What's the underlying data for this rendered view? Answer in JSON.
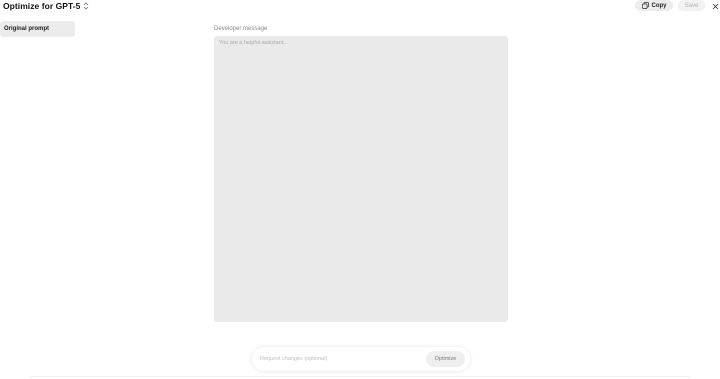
{
  "header": {
    "title": "Optimize for GPT-5",
    "copy_label": "Copy",
    "save_label": "Save"
  },
  "sidebar": {
    "items": [
      {
        "label": "Original prompt"
      }
    ]
  },
  "main": {
    "developer_label": "Developer message",
    "developer_placeholder": "You are a helpful assistant...",
    "developer_value": ""
  },
  "bottom": {
    "request_placeholder": "Request changes (optional)",
    "optimize_label": "Optimize"
  },
  "icons": {
    "title_chevron": "chevron-up-down-icon",
    "copy": "copy-icon",
    "close": "close-icon"
  }
}
